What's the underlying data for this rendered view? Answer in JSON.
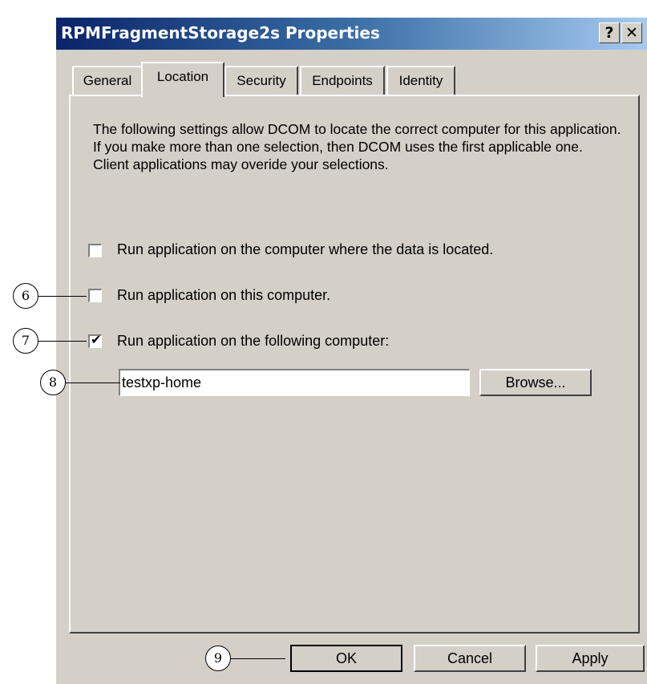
{
  "dialog": {
    "title": "RPMFragmentStorage2s Properties",
    "help_label": "?",
    "close_label": "✕"
  },
  "tabs": [
    {
      "label": "General",
      "active": false
    },
    {
      "label": "Location",
      "active": true
    },
    {
      "label": "Security",
      "active": false
    },
    {
      "label": "Endpoints",
      "active": false
    },
    {
      "label": "Identity",
      "active": false
    }
  ],
  "location": {
    "description": "The following settings allow DCOM to locate the correct computer for this application. If you make more than one selection, then DCOM uses the first applicable one. Client applications may overide your selections.",
    "options": [
      {
        "label": "Run application on the computer where the data is located.",
        "checked": false
      },
      {
        "label": "Run application on this computer.",
        "checked": false
      },
      {
        "label": "Run application on the following computer:",
        "checked": true
      }
    ],
    "computer_value": "testxp-home",
    "browse_label": "Browse..."
  },
  "footer": {
    "ok_label": "OK",
    "cancel_label": "Cancel",
    "apply_label": "Apply"
  },
  "callouts": [
    "6",
    "7",
    "8",
    "9"
  ]
}
